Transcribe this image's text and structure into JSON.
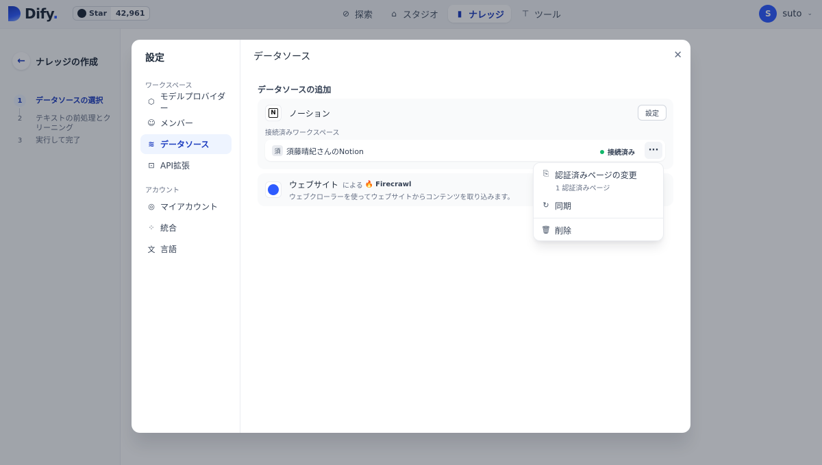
{
  "header": {
    "logo_text": "Dify",
    "github": {
      "star_label": "Star",
      "count": "42,961"
    },
    "nav": [
      {
        "label": "探索",
        "icon": "compass-icon"
      },
      {
        "label": "スタジオ",
        "icon": "robot-icon"
      },
      {
        "label": "ナレッジ",
        "icon": "book-icon",
        "active": true
      },
      {
        "label": "ツール",
        "icon": "hammer-icon"
      }
    ],
    "user": {
      "avatar_letter": "S",
      "name": "suto"
    }
  },
  "background_page": {
    "title": "ナレッジの作成",
    "steps": [
      {
        "num": "1",
        "label": "データソースの選択",
        "active": true
      },
      {
        "num": "2",
        "label": "テキストの前処理とクリーニング"
      },
      {
        "num": "3",
        "label": "実行して完了"
      }
    ]
  },
  "settings_modal": {
    "title": "設定",
    "groups": {
      "workspace": "ワークスペース",
      "account": "アカウント"
    },
    "items": {
      "model_provider": "モデルプロバイダー",
      "members": "メンバー",
      "data_source": "データソース",
      "api_extension": "API拡張",
      "my_account": "マイアカウント",
      "integrations": "統合",
      "language": "言語"
    },
    "main_title": "データソース",
    "section_title": "データソースの追加",
    "notion": {
      "name": "ノーション",
      "config_label": "設定",
      "connected_label": "接続済みワークスペース",
      "workspace": {
        "avatar_letter": "須",
        "name": "須藤晴紀さんのNotion",
        "status": "接続済み",
        "more": "···"
      }
    },
    "website": {
      "name": "ウェブサイト",
      "by": "による",
      "provider": "Firecrawl",
      "description": "ウェブクローラーを使ってウェブサイトからコンテンツを取り込みます。"
    },
    "dropdown": {
      "change_pages": "認証済みページの変更",
      "pages_count": "1 認証済みページ",
      "sync": "同期",
      "delete": "削除"
    }
  }
}
